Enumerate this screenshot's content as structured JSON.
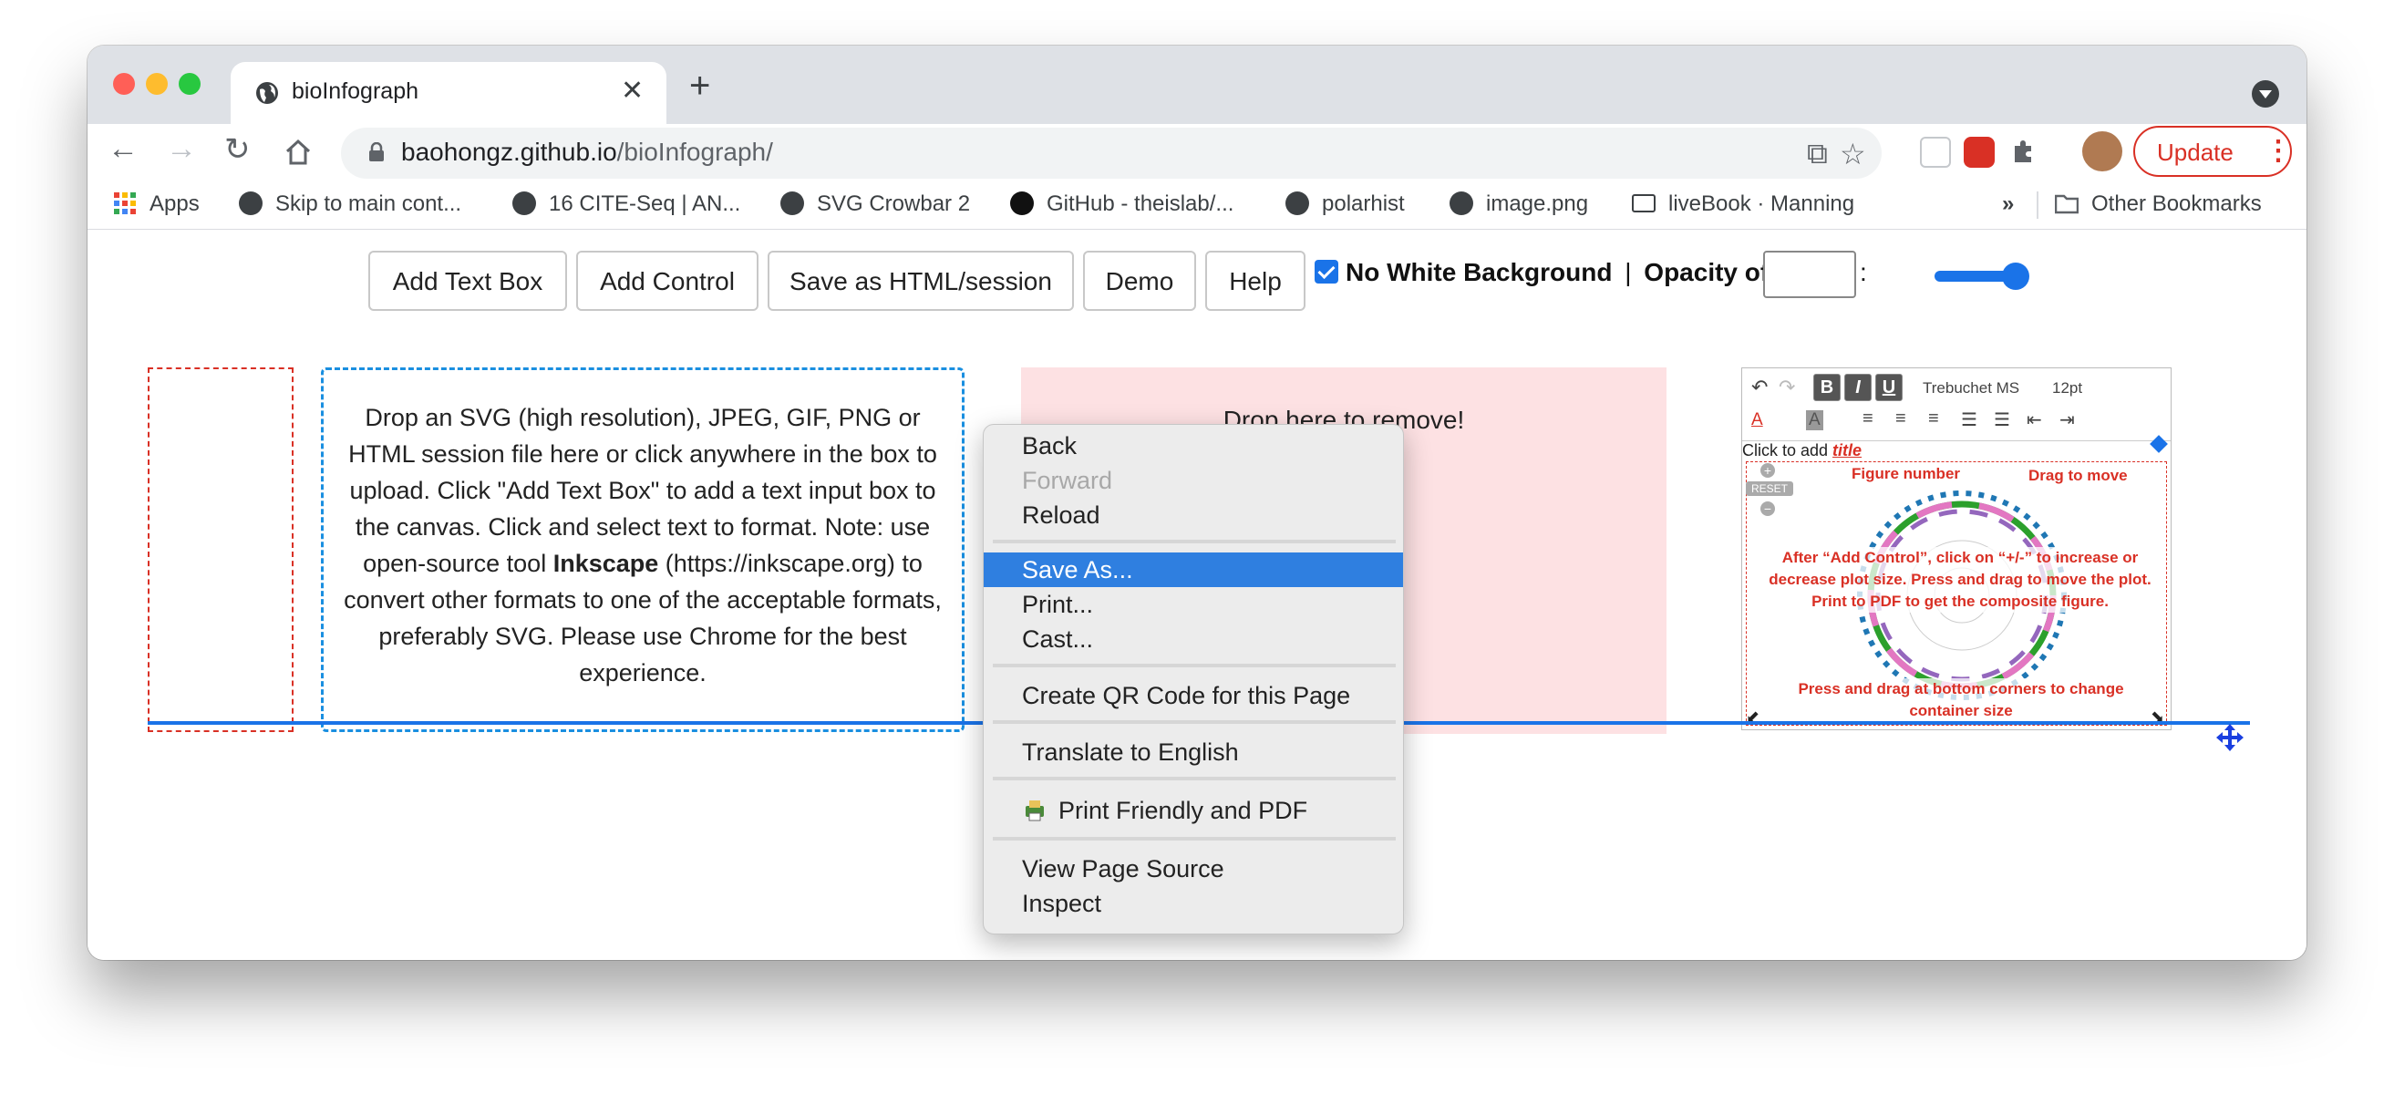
{
  "browser": {
    "tab_title": "bioInfograph",
    "url_domain": "baohongz.github.io",
    "url_path": "/bioInfograph/",
    "update_label": "Update",
    "bookmarks": [
      "Apps",
      "Skip to main cont...",
      "16 CITE-Seq | AN...",
      "SVG Crowbar 2",
      "GitHub - theislab/...",
      "polarhist",
      "image.png",
      "liveBook · Manning"
    ],
    "more_bookmarks": "»",
    "other_bookmarks": "Other Bookmarks"
  },
  "page": {
    "buttons": [
      "Add Text Box",
      "Add Control",
      "Save as HTML/session",
      "Demo",
      "Help"
    ],
    "no_white_bg_label": "No White Background",
    "separator": "|",
    "opacity_label": "Opacity of",
    "colon": ":",
    "drop_text_1": "Drop an SVG (high resolution), JPEG, GIF, PNG or HTML session file here or click anywhere in the box to upload. Click \"Add Text Box\" to add a text input box to the canvas. Click and select text to format. Note: use open-source tool ",
    "drop_text_bold": "Inkscape",
    "drop_text_2": " (https://inkscape.org) to convert other formats to one of the acceptable formats, preferably SVG. Please use Chrome for the best experience.",
    "remove_text": "Drop here to remove!",
    "editor": {
      "font": "Trebuchet MS",
      "size": "12pt",
      "bold": "B",
      "italic": "I",
      "underline": "U",
      "click_prefix": "Click to add ",
      "click_title": "title",
      "reset": "RESET",
      "figure_number": "Figure number",
      "drag_to_move": "Drag to move",
      "instructions": "After “Add Control”, click on “+/-” to increase or decrease plot size. Press and drag to move the plot. Print to PDF to get the composite figure.",
      "corners": "Press and drag at bottom corners to change container size"
    }
  },
  "context_menu": {
    "back": "Back",
    "forward": "Forward",
    "reload": "Reload",
    "save_as": "Save As...",
    "print": "Print...",
    "cast": "Cast...",
    "qr": "Create QR Code for this Page",
    "translate": "Translate to English",
    "print_friendly": "Print Friendly and PDF",
    "view_source": "View Page Source",
    "inspect": "Inspect"
  },
  "colors": {
    "accent": "#1a73e8",
    "menu_highlight": "#2f7fe0",
    "remove_zone": "#fde1e3",
    "red": "#d93025"
  }
}
